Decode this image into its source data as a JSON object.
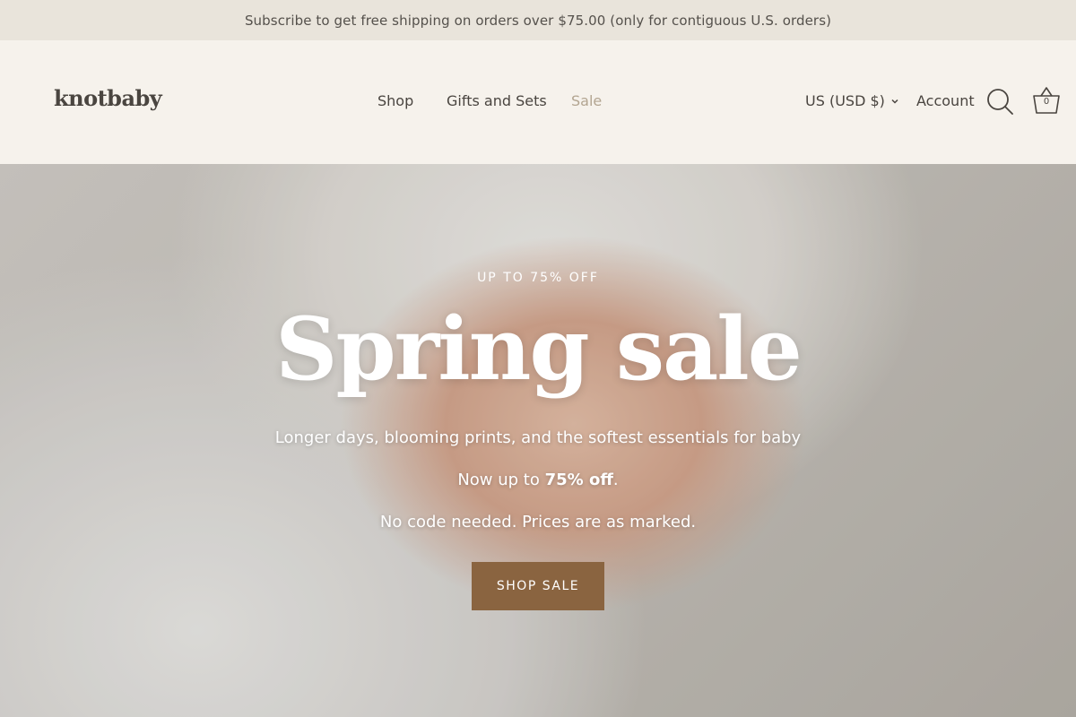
{
  "announcement": "Subscribe to get free shipping on orders over $75.00 (only for contiguous U.S. orders)",
  "header": {
    "logo": "knotbaby",
    "nav": [
      {
        "label": "Shop"
      },
      {
        "label": "Gifts and Sets"
      },
      {
        "label": "Sale"
      }
    ],
    "currency": "US (USD $)",
    "account": "Account",
    "search_icon": "search-icon",
    "cart_icon": "basket-icon",
    "cart_count": "0"
  },
  "hero": {
    "eyebrow": "UP TO 75% OFF",
    "headline": "Spring sale",
    "line1": "Longer days, blooming prints, and the softest essentials for baby",
    "line2_prefix": "Now up to ",
    "line2_bold": "75% off",
    "line2_suffix": ".",
    "line3": "No code needed. Prices are as marked.",
    "cta": "SHOP SALE"
  },
  "colors": {
    "announcement_bg": "#e9e4db",
    "header_bg": "#f6f2ec",
    "sale_link": "#b3a591",
    "cta_bg": "#8a6440"
  }
}
